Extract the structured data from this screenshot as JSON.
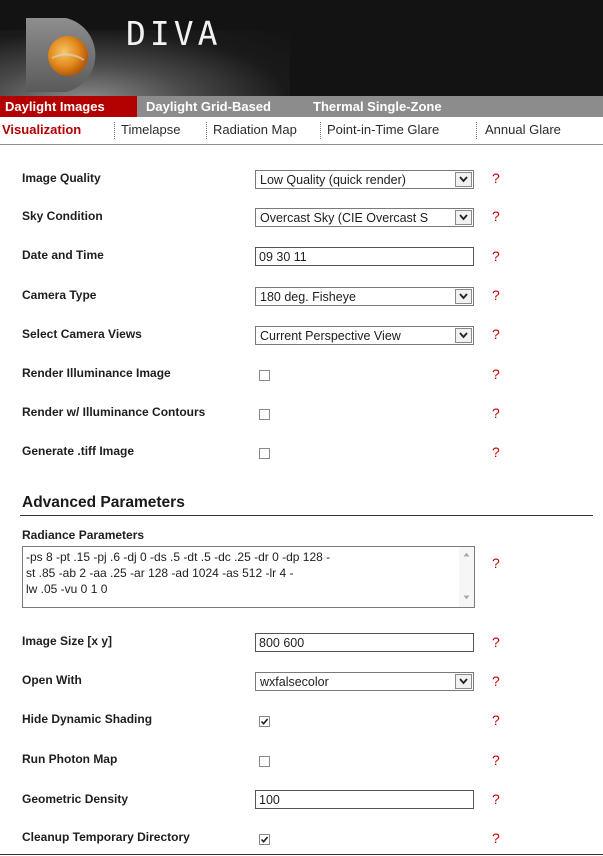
{
  "app": {
    "title": "DIVA"
  },
  "main_tabs": [
    {
      "label": "Daylight Images",
      "active": true
    },
    {
      "label": "Daylight Grid-Based",
      "active": false
    },
    {
      "label": "Thermal Single-Zone",
      "active": false
    }
  ],
  "sub_tabs": [
    {
      "label": "Visualization",
      "active": true
    },
    {
      "label": "Timelapse",
      "active": false
    },
    {
      "label": "Radiation Map",
      "active": false
    },
    {
      "label": "Point-in-Time Glare",
      "active": false
    },
    {
      "label": "Annual Glare",
      "active": false
    }
  ],
  "help_glyph": "?",
  "fields": {
    "image_quality": {
      "label": "Image Quality",
      "value": "Low Quality (quick render)"
    },
    "sky_condition": {
      "label": "Sky Condition",
      "value": "Overcast Sky (CIE Overcast S"
    },
    "date_time": {
      "label": "Date and Time",
      "value": "09 30 11"
    },
    "camera_type": {
      "label": "Camera Type",
      "value": "180 deg. Fisheye"
    },
    "camera_views": {
      "label": "Select Camera Views",
      "value": "Current Perspective View"
    },
    "render_illuminance": {
      "label": "Render Illuminance Image",
      "checked": false
    },
    "render_contours": {
      "label": "Render w/ Illuminance Contours",
      "checked": false
    },
    "generate_tiff": {
      "label": "Generate .tiff Image",
      "checked": false
    }
  },
  "advanced": {
    "title": "Advanced Parameters",
    "radiance": {
      "label": "Radiance Parameters",
      "lines": [
        "-ps 8 -pt .15 -pj .6 -dj 0 -ds .5 -dt .5 -dc .25 -dr 0 -dp 128 -",
        "st .85 -ab 2 -aa .25 -ar 128 -ad 1024 -as 512 -lr 4 -",
        "lw .05 -vu 0 1 0"
      ]
    },
    "image_size": {
      "label": "Image Size [x y]",
      "value": "800 600"
    },
    "open_with": {
      "label": "Open With",
      "value": "wxfalsecolor"
    },
    "hide_shading": {
      "label": "Hide Dynamic Shading",
      "checked": true
    },
    "photon_map": {
      "label": "Run Photon Map",
      "checked": false
    },
    "geometric_density": {
      "label": "Geometric Density",
      "value": "100"
    },
    "cleanup": {
      "label": "Cleanup Temporary Directory",
      "checked": true
    }
  },
  "colors": {
    "accent": "#b30000",
    "help": "#c80000",
    "tab_bar": "#8c8c8c",
    "header": "#131313"
  }
}
